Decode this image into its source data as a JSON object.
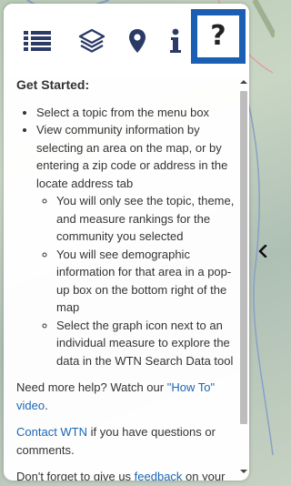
{
  "toolbar": {
    "tools": [
      {
        "icon": "list-icon",
        "active": false
      },
      {
        "icon": "layers-icon",
        "active": false
      },
      {
        "icon": "map-marker-icon",
        "active": false
      },
      {
        "icon": "info-icon",
        "active": false
      },
      {
        "icon": "question-icon",
        "active": true
      }
    ],
    "help_glyph": "?",
    "info_glyph": "i",
    "accent_color": "#1a5fb4",
    "icon_color": "#2b3a67"
  },
  "help": {
    "heading": "Get Started:",
    "bullets": {
      "b1": "Select a topic from the menu box",
      "b2": "View community information by selecting an area on the map, or by entering a zip code or address in the locate address tab",
      "sub1": "You will only see the topic, theme, and measure rankings for the community you selected",
      "sub2": "You will see demographic information for that area in a pop-up box on the bottom right of the map",
      "sub3": "Select the graph icon next to an individual measure to explore the data in the WTN Search Data tool"
    },
    "p1_text": "Need more help? Watch our ",
    "p1_link": "\"How To\" video",
    "p1_end": ".",
    "p2_link": "Contact WTN",
    "p2_text": " if you have questions or comments.",
    "p3_text": "Don't forget to give us ",
    "p3_link": "feedback",
    "p3_end": " on your experience!",
    "link_color": "#1a66b8"
  }
}
